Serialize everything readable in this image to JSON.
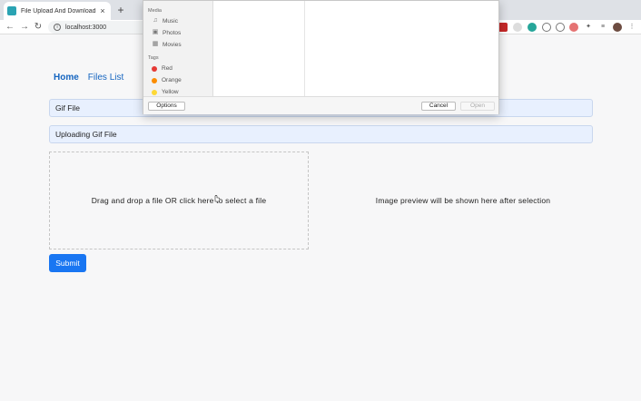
{
  "browser": {
    "tab_title": "File Upload And Download",
    "tab_close": "×",
    "new_tab": "+",
    "url": "localhost:3000",
    "back": "←",
    "forward": "→",
    "reload": "↻"
  },
  "nav": {
    "home": "Home",
    "files_list": "Files List"
  },
  "form": {
    "title_value": "Gif File",
    "description_value": "Uploading Gif File",
    "dropzone_text": "Drag and drop a file OR click here to select a file",
    "preview_text": "Image preview will be shown here after selection",
    "submit_label": "Submit"
  },
  "dialog": {
    "media_heading": "Media",
    "media_items": [
      "Music",
      "Photos",
      "Movies"
    ],
    "tags_heading": "Tags",
    "tags": [
      {
        "label": "Red",
        "color": "#e53935"
      },
      {
        "label": "Orange",
        "color": "#fb8c00"
      },
      {
        "label": "Yellow",
        "color": "#fdd835"
      }
    ],
    "options_label": "Options",
    "cancel_label": "Cancel",
    "open_label": "Open"
  },
  "colors": {
    "accent": "#1976f2",
    "link": "#1565c0"
  }
}
